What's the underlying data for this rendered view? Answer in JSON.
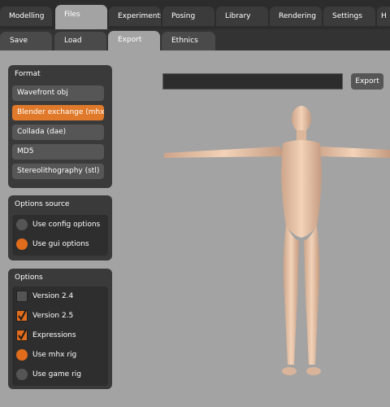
{
  "top_tabs": [
    {
      "label": "Modelling",
      "active": false
    },
    {
      "label": "Files",
      "active": true
    },
    {
      "label": "Experiments",
      "active": false
    },
    {
      "label": "Posing",
      "active": false
    },
    {
      "label": "Library",
      "active": false
    },
    {
      "label": "Rendering",
      "active": false
    },
    {
      "label": "Settings",
      "active": false
    },
    {
      "label": "H",
      "active": false
    }
  ],
  "sub_tabs": [
    {
      "label": "Save",
      "active": false
    },
    {
      "label": "Load",
      "active": false
    },
    {
      "label": "Export",
      "active": true
    },
    {
      "label": "Ethnics",
      "active": false
    }
  ],
  "format": {
    "title": "Format",
    "items": [
      "Wavefront obj",
      "Blender exchange (mhx)",
      "Collada (dae)",
      "MD5",
      "Stereolithography (stl)"
    ],
    "selected": "Blender exchange (mhx)"
  },
  "options_source": {
    "title": "Options source",
    "items": [
      {
        "label": "Use config options",
        "checked": false
      },
      {
        "label": "Use gui options",
        "checked": true
      }
    ]
  },
  "options": {
    "title": "Options",
    "items": [
      {
        "label": "Version 2.4",
        "kind": "checkbox",
        "checked": false
      },
      {
        "label": "Version 2.5",
        "kind": "checkbox",
        "checked": true
      },
      {
        "label": "Expressions",
        "kind": "checkbox",
        "checked": true
      },
      {
        "label": "Use mhx rig",
        "kind": "radio",
        "checked": true
      },
      {
        "label": "Use game rig",
        "kind": "radio",
        "checked": false
      }
    ]
  },
  "export": {
    "filename_value": "",
    "button_label": "Export"
  },
  "colors": {
    "accent": "#e07a2a",
    "background": "#a3a3a3",
    "panel": "#3a3a3a"
  }
}
